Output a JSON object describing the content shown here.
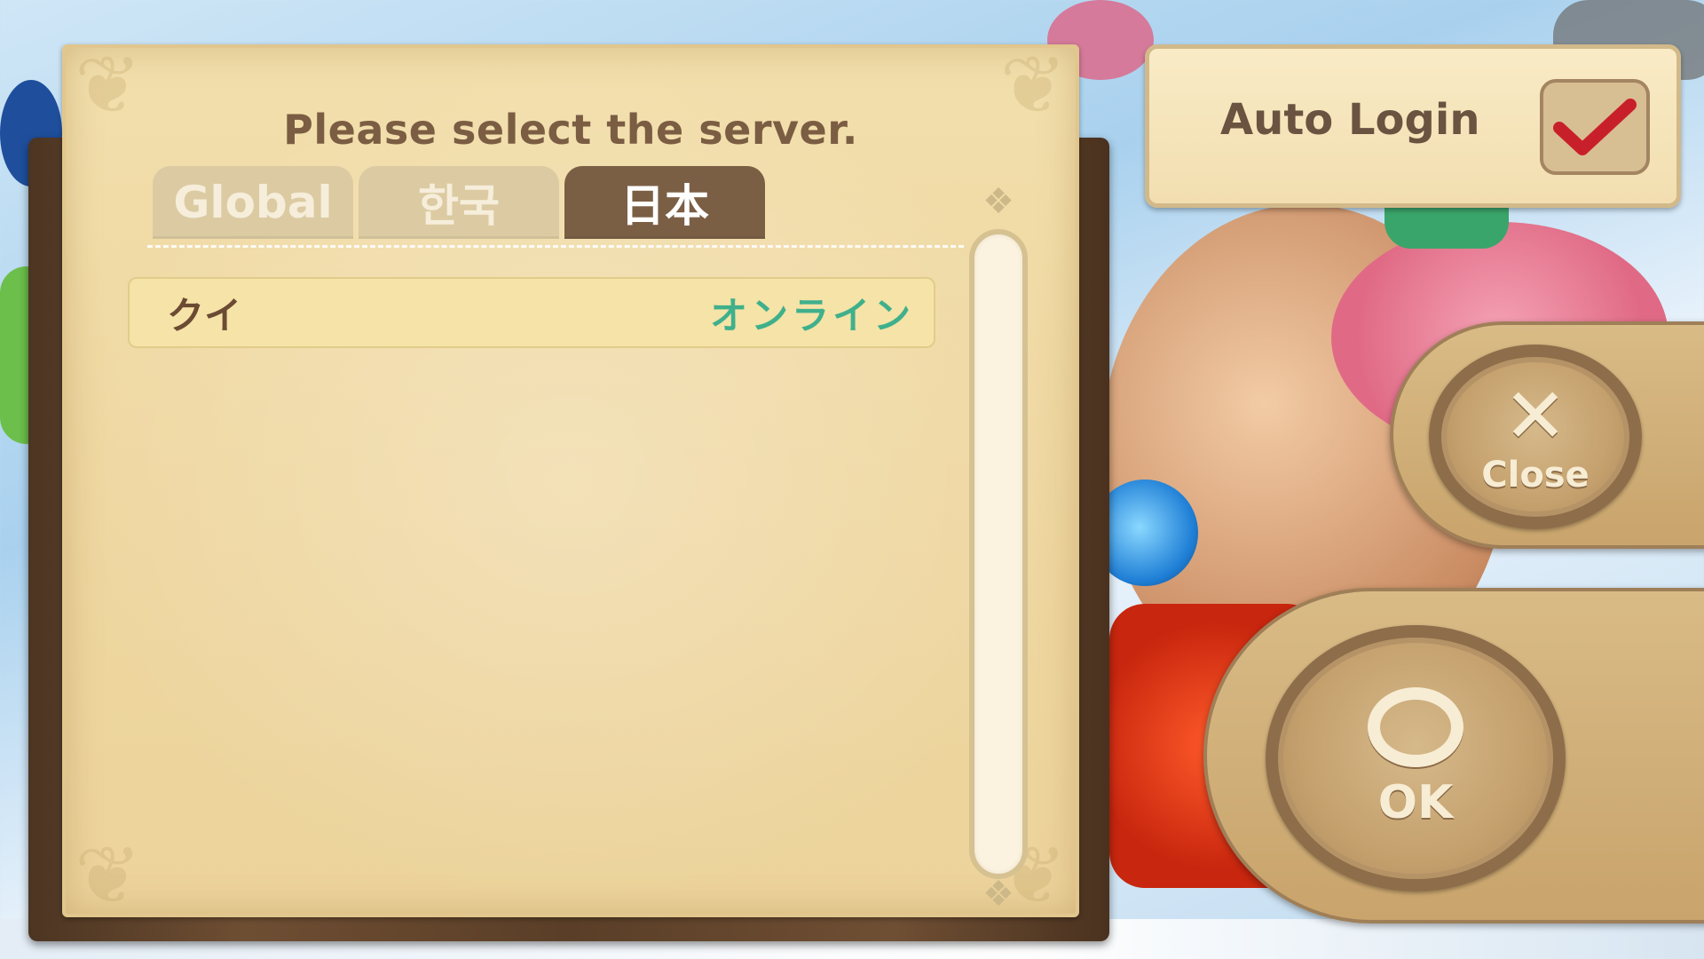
{
  "dialog": {
    "title": "Please select the server.",
    "tabs": [
      {
        "label": "Global",
        "active": false
      },
      {
        "label": "한국",
        "active": false
      },
      {
        "label": "日本",
        "active": true
      }
    ],
    "servers": [
      {
        "name": "クイ",
        "status": "オンライン",
        "status_color": "#3fb08b"
      }
    ]
  },
  "auto_login": {
    "label": "Auto Login",
    "checked": true,
    "check_color": "#c8202a"
  },
  "buttons": {
    "close": {
      "icon": "close-x-icon",
      "label": "Close"
    },
    "ok": {
      "icon": "circle-o-icon",
      "label": "OK"
    }
  },
  "colors": {
    "active_tab": "#7b5f45",
    "inactive_tab": "#dccba2",
    "paper": "#efd7a1",
    "wood": "#5a3e27"
  }
}
